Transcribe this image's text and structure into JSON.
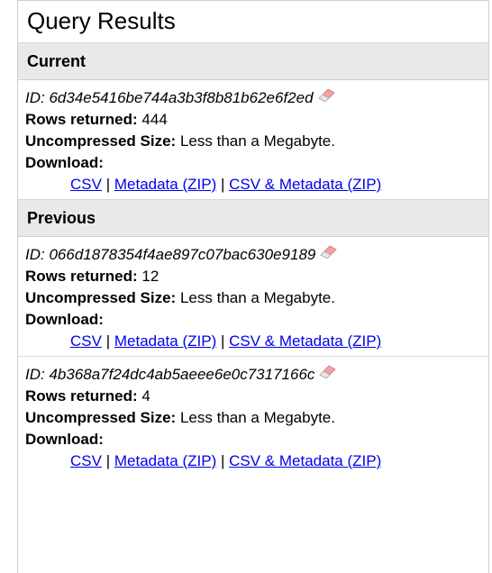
{
  "title": "Query Results",
  "sections": {
    "current": {
      "heading": "Current",
      "entries": [
        {
          "id_prefix": "ID: ",
          "id": "6d34e5416be744a3b3f8b81b62e6f2ed",
          "rows_label": "Rows returned:",
          "rows_value": "444",
          "size_label": "Uncompressed Size:",
          "size_value": "Less than a Megabyte.",
          "download_label": "Download:",
          "link_csv": "CSV",
          "link_metadata": "Metadata (ZIP)",
          "link_csv_metadata": "CSV & Metadata (ZIP)"
        }
      ]
    },
    "previous": {
      "heading": "Previous",
      "entries": [
        {
          "id_prefix": "ID: ",
          "id": "066d1878354f4ae897c07bac630e9189",
          "rows_label": "Rows returned:",
          "rows_value": "12",
          "size_label": "Uncompressed Size:",
          "size_value": "Less than a Megabyte.",
          "download_label": "Download:",
          "link_csv": "CSV",
          "link_metadata": "Metadata (ZIP)",
          "link_csv_metadata": "CSV & Metadata (ZIP)"
        },
        {
          "id_prefix": "ID: ",
          "id": "4b368a7f24dc4ab5aeee6e0c7317166c",
          "rows_label": "Rows returned:",
          "rows_value": "4",
          "size_label": "Uncompressed Size:",
          "size_value": "Less than a Megabyte.",
          "download_label": "Download:",
          "link_csv": "CSV",
          "link_metadata": "Metadata (ZIP)",
          "link_csv_metadata": "CSV & Metadata (ZIP)"
        }
      ]
    }
  },
  "separator": "|",
  "icons": {
    "eraser": "eraser-icon"
  },
  "colors": {
    "link": "#0000ee",
    "section_bg": "#e9e9e9",
    "eraser_pink": "#f08a8a"
  }
}
